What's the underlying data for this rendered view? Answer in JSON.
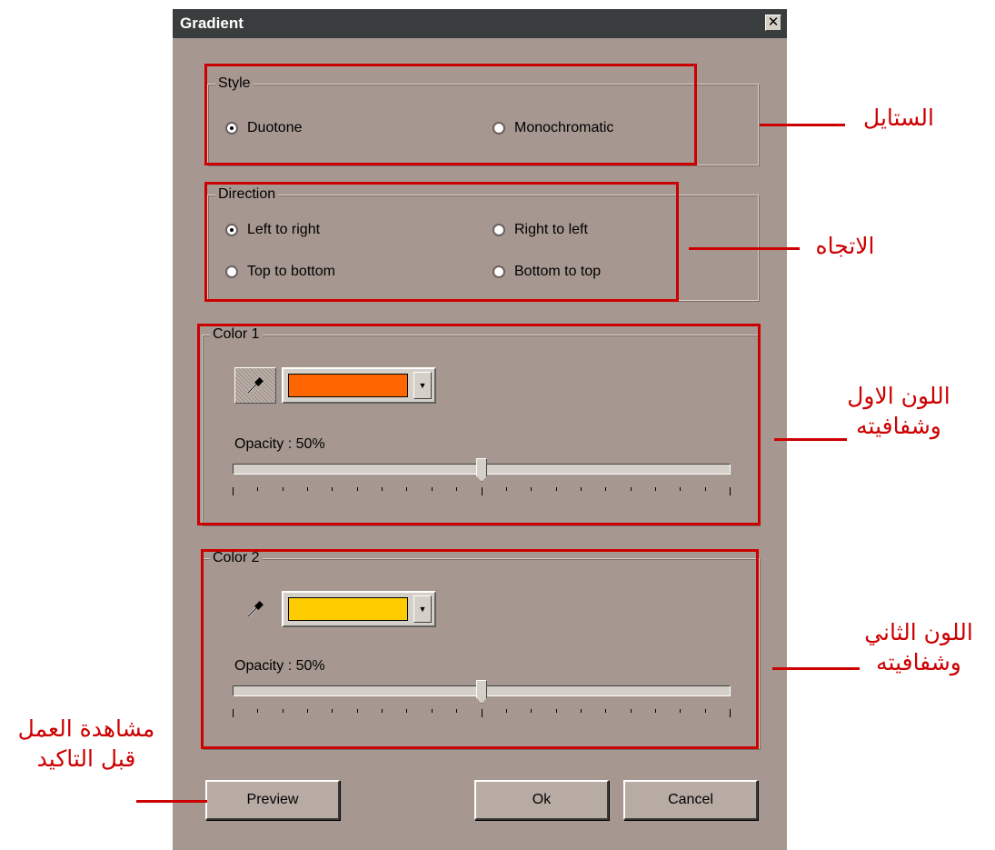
{
  "dialog": {
    "title": "Gradient",
    "close_symbol": "✕",
    "style": {
      "legend": "Style",
      "options": [
        {
          "label": "Duotone",
          "checked": true
        },
        {
          "label": "Monochromatic",
          "checked": false
        }
      ]
    },
    "direction": {
      "legend": "Direction",
      "options": [
        {
          "label": "Left to right",
          "checked": true
        },
        {
          "label": "Right to left",
          "checked": false
        },
        {
          "label": "Top to bottom",
          "checked": false
        },
        {
          "label": "Bottom to top",
          "checked": false
        }
      ]
    },
    "color1": {
      "legend": "Color 1",
      "swatch_color": "#ff6600",
      "opacity_label": "Opacity : 50%",
      "opacity_value": 50,
      "picker_icon": "eyedropper-icon"
    },
    "color2": {
      "legend": "Color 2",
      "swatch_color": "#ffcc00",
      "opacity_label": "Opacity : 50%",
      "opacity_value": 50,
      "picker_icon": "eyedropper-icon"
    },
    "buttons": {
      "preview": "Preview",
      "ok": "Ok",
      "cancel": "Cancel"
    }
  },
  "annotations": {
    "style": "الستايل",
    "direction": "الاتجاه",
    "color1_line1": "اللون الاول",
    "color1_line2": "وشفافيته",
    "color2_line1": "اللون الثاني",
    "color2_line2": "وشفافيته",
    "preview_line1": "مشاهدة العمل",
    "preview_line2": "قبل التاكيد",
    "accent_color": "#cc0000"
  }
}
